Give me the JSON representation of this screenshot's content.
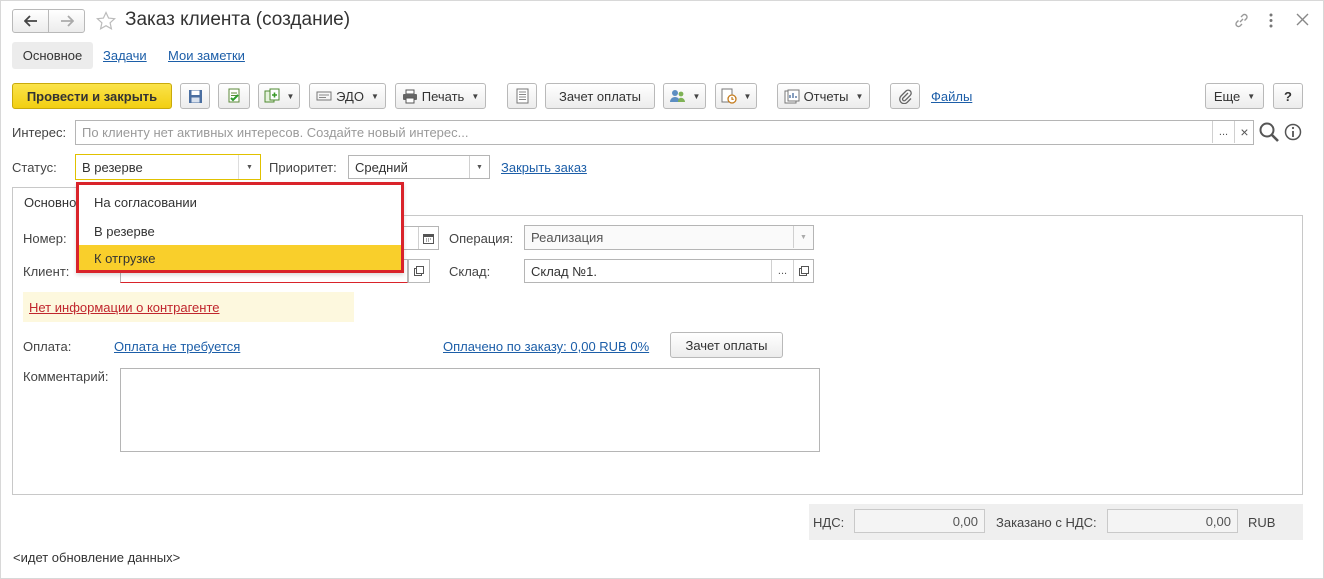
{
  "window": {
    "title": "Заказ клиента (создание)"
  },
  "tabs": [
    {
      "label": "Основное",
      "active": true
    },
    {
      "label": "Задачи",
      "active": false
    },
    {
      "label": "Мои заметки",
      "active": false
    }
  ],
  "toolbar": {
    "post_close": "Провести и закрыть",
    "edo": "ЭДО",
    "print": "Печать",
    "payment_offset": "Зачет оплаты",
    "reports": "Отчеты",
    "files": "Файлы",
    "more": "Еще",
    "help": "?"
  },
  "interest": {
    "label": "Интерес:",
    "placeholder": "По клиенту нет активных интересов. Создайте новый интерес...",
    "select_btn": "...",
    "clear_btn": "×"
  },
  "status_row": {
    "status_label": "Статус:",
    "status_value": "В резерве",
    "priority_label": "Приоритет:",
    "priority_value": "Средний",
    "close_order": "Закрыть заказ"
  },
  "dropdown": {
    "options": [
      "На согласовании",
      "В резерве",
      "К отгрузке"
    ],
    "highlighted": "К отгрузке",
    "highlight_color": "#f9cf2b",
    "frame_color": "#d9232a"
  },
  "form": {
    "tab_label": "Основное",
    "number_label": "Номер:",
    "client_label": "Клиент:",
    "operation_label": "Операция:",
    "operation_value": "Реализация",
    "warehouse_label": "Склад:",
    "warehouse_value": "Склад №1.",
    "contractor_warning": "Нет информации о контрагенте",
    "payment_label": "Оплата:",
    "payment_link": "Оплата не требуется",
    "paid_link": "Оплачено по заказу: 0,00 RUB 0%",
    "payment_offset_btn": "Зачет оплаты",
    "comment_label": "Комментарий:"
  },
  "totals": {
    "vat_label": "НДС:",
    "vat_value": "0,00",
    "ordered_label": "Заказано с НДС:",
    "ordered_value": "0,00",
    "currency": "RUB"
  },
  "status_bar": {
    "text": "<идет обновление данных>"
  },
  "colors": {
    "primary_button": "#f6d61d",
    "link": "#1c5ea8",
    "warning_text": "#c0262d",
    "warning_bg": "#fdf8de"
  }
}
